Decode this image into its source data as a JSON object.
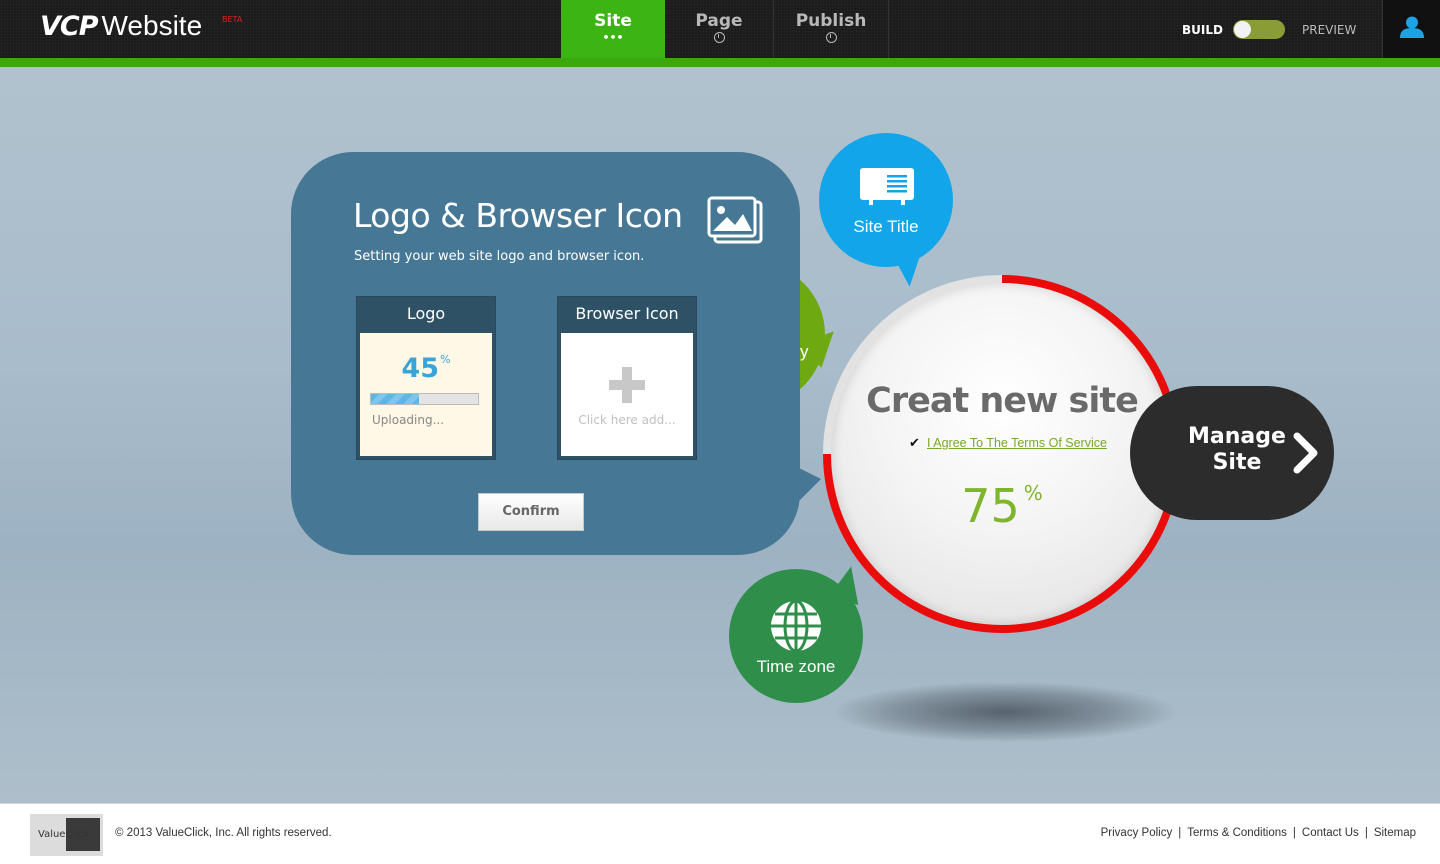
{
  "header": {
    "brand_vcp": "VCP",
    "brand_website": "Website",
    "brand_badge": "BETA",
    "tabs": [
      {
        "label": "Site",
        "sub": "•••",
        "active": true
      },
      {
        "label": "Page",
        "sub_icon": "clock-icon"
      },
      {
        "label": "Publish",
        "sub_icon": "clock-icon"
      }
    ],
    "build_label": "BUILD",
    "preview_label": "PREVIEW",
    "user_icon": "user-icon"
  },
  "panel": {
    "title": "Logo & Browser Icon",
    "subtitle": "Setting your web site logo and browser icon.",
    "logo_slot": {
      "title": "Logo",
      "progress_percent": 45,
      "progress_value": "45",
      "progress_unit": "%",
      "status": "Uploading..."
    },
    "icon_slot": {
      "title": "Browser Icon",
      "placeholder": "Click here add..."
    },
    "confirm_label": "Confirm"
  },
  "bubbles": {
    "partial_label": "y",
    "site_title": "Site Title",
    "time_zone": "Time zone"
  },
  "create": {
    "title": "Creat new site",
    "agree_label": "I Agree To The Terms Of Service",
    "agree_checked": true,
    "progress_value": "75",
    "progress_unit": "%"
  },
  "manage": {
    "line1": "Manage",
    "line2": "Site"
  },
  "footer": {
    "logo_text": "ValueClick",
    "copyright": "© 2013 ValueClick, Inc. All rights reserved.",
    "links": [
      "Privacy Policy",
      "Terms & Conditions",
      "Contact Us",
      "Sitemap"
    ]
  },
  "colors": {
    "accent_green": "#3cb413",
    "panel_blue": "#467895",
    "site_title_blue": "#12a5ea",
    "timezone_green": "#2f8f4a",
    "progress_red": "#ea0b0b",
    "manage_dark": "#2c2c2c"
  }
}
